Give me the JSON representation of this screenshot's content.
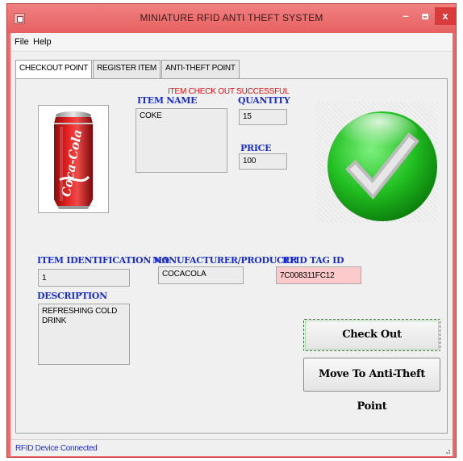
{
  "window": {
    "title": "MINIATURE RFID ANTI THEFT SYSTEM"
  },
  "menu": {
    "file": "File",
    "help": "Help"
  },
  "tabs": [
    {
      "label": "CHECKOUT POINT",
      "active": true
    },
    {
      "label": "REGISTER ITEM",
      "active": false
    },
    {
      "label": "ANTI-THEFT POINT",
      "active": false
    }
  ],
  "checkout": {
    "status_message": "ITEM CHECK OUT SUCCESSFUL",
    "item_name_label": "ITEM NAME",
    "item_name": "COKE",
    "quantity_label": "QUANTITY",
    "quantity": "15",
    "price_label": "PRICE",
    "price": "100",
    "item_id_label": "ITEM IDENTIFICATION NO",
    "item_id": "1",
    "manufacturer_label": "MANUFACTURER/PRODUCER",
    "manufacturer": "COCACOLA",
    "rfid_label": "RFID TAG ID",
    "rfid": "7C008311FC12",
    "description_label": "DESCRIPTION",
    "description": "REFRESHING COLD DRINK",
    "product_brand": "Coca-Cola",
    "checkout_button": "Check Out",
    "move_button": "Move To Anti-Theft Point"
  },
  "icons": {
    "success": "check-mark-icon",
    "product": "soda-can-icon"
  },
  "colors": {
    "titlebar": "#ee6a6a",
    "label_blue": "#1a2ecc",
    "success_green": "#22b022",
    "error_red": "#e01010",
    "rfid_field": "#fccaca"
  },
  "statusbar": {
    "text": "RFID Device Connected"
  }
}
